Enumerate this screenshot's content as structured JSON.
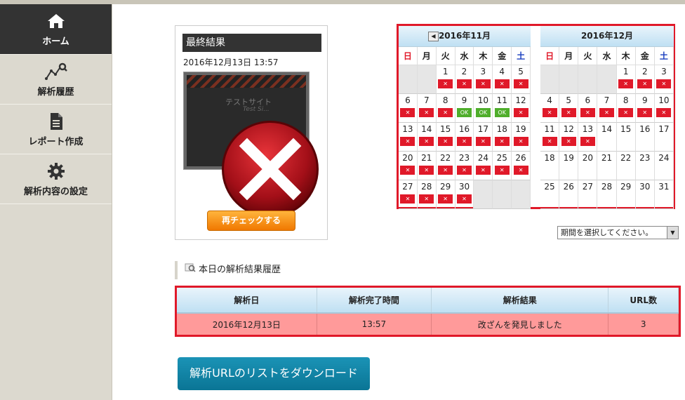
{
  "nav": [
    {
      "label": "ホーム",
      "icon": "home-icon",
      "active": true
    },
    {
      "label": "解析履歴",
      "icon": "analysis-chart-icon",
      "active": false
    },
    {
      "label": "レポート作成",
      "icon": "report-document-icon",
      "active": false
    },
    {
      "label": "解析内容の設定",
      "icon": "gear-icon",
      "active": false
    }
  ],
  "result": {
    "title": "最終結果",
    "datetime": "2016年12月13日 13:57",
    "thumb_text": "テストサイト",
    "thumb_sub": "Test Si...",
    "recheck_label": "再チェックする"
  },
  "calendar": {
    "weekdays": [
      "日",
      "月",
      "火",
      "水",
      "木",
      "金",
      "土"
    ],
    "months": [
      {
        "title": "2016年11月",
        "has_prev": true,
        "lead_blanks": 2,
        "days": [
          {
            "d": "1",
            "s": "ng"
          },
          {
            "d": "2",
            "s": "ng"
          },
          {
            "d": "3",
            "s": "ng"
          },
          {
            "d": "4",
            "s": "ng"
          },
          {
            "d": "5",
            "s": "ng"
          },
          {
            "d": "6",
            "s": "ng"
          },
          {
            "d": "7",
            "s": "ng"
          },
          {
            "d": "8",
            "s": "ng"
          },
          {
            "d": "9",
            "s": "ok"
          },
          {
            "d": "10",
            "s": "ok"
          },
          {
            "d": "11",
            "s": "ok"
          },
          {
            "d": "12",
            "s": "ng"
          },
          {
            "d": "13",
            "s": "ng"
          },
          {
            "d": "14",
            "s": "ng"
          },
          {
            "d": "15",
            "s": "ng"
          },
          {
            "d": "16",
            "s": "ng"
          },
          {
            "d": "17",
            "s": "ng"
          },
          {
            "d": "18",
            "s": "ng"
          },
          {
            "d": "19",
            "s": "ng"
          },
          {
            "d": "20",
            "s": "ng"
          },
          {
            "d": "21",
            "s": "ng"
          },
          {
            "d": "22",
            "s": "ng"
          },
          {
            "d": "23",
            "s": "ng"
          },
          {
            "d": "24",
            "s": "ng"
          },
          {
            "d": "25",
            "s": "ng"
          },
          {
            "d": "26",
            "s": "ng"
          },
          {
            "d": "27",
            "s": "ng"
          },
          {
            "d": "28",
            "s": "ng"
          },
          {
            "d": "29",
            "s": "ng"
          },
          {
            "d": "30",
            "s": "ng"
          }
        ]
      },
      {
        "title": "2016年12月",
        "has_prev": false,
        "lead_blanks": 4,
        "days": [
          {
            "d": "1",
            "s": "ng"
          },
          {
            "d": "2",
            "s": "ng"
          },
          {
            "d": "3",
            "s": "ng"
          },
          {
            "d": "4",
            "s": "ng"
          },
          {
            "d": "5",
            "s": "ng"
          },
          {
            "d": "6",
            "s": "ng"
          },
          {
            "d": "7",
            "s": "ng"
          },
          {
            "d": "8",
            "s": "ng"
          },
          {
            "d": "9",
            "s": "ng"
          },
          {
            "d": "10",
            "s": "ng"
          },
          {
            "d": "11",
            "s": "ng"
          },
          {
            "d": "12",
            "s": "ng"
          },
          {
            "d": "13",
            "s": "ng"
          },
          {
            "d": "14",
            "s": ""
          },
          {
            "d": "15",
            "s": ""
          },
          {
            "d": "16",
            "s": ""
          },
          {
            "d": "17",
            "s": ""
          },
          {
            "d": "18",
            "s": ""
          },
          {
            "d": "19",
            "s": ""
          },
          {
            "d": "20",
            "s": ""
          },
          {
            "d": "21",
            "s": ""
          },
          {
            "d": "22",
            "s": ""
          },
          {
            "d": "23",
            "s": ""
          },
          {
            "d": "24",
            "s": ""
          },
          {
            "d": "25",
            "s": ""
          },
          {
            "d": "26",
            "s": ""
          },
          {
            "d": "27",
            "s": ""
          },
          {
            "d": "28",
            "s": ""
          },
          {
            "d": "29",
            "s": ""
          },
          {
            "d": "30",
            "s": ""
          },
          {
            "d": "31",
            "s": ""
          }
        ]
      }
    ],
    "ng_mark": "✕",
    "ok_mark": "OK"
  },
  "period_select": {
    "value": "期間を選択してください。",
    "arrow": "▼"
  },
  "history": {
    "title": "本日の解析結果履歴",
    "headers": [
      "解析日",
      "解析完了時間",
      "解析結果",
      "URL数"
    ],
    "rows": [
      [
        "2016年12月13日",
        "13:57",
        "改ざんを発見しました",
        "3"
      ]
    ]
  },
  "download_label": "解析URLのリストをダウンロード",
  "colors": {
    "alert_red": "#e01929",
    "ok_green": "#4fae2b",
    "download_blue": "#0a7595"
  }
}
